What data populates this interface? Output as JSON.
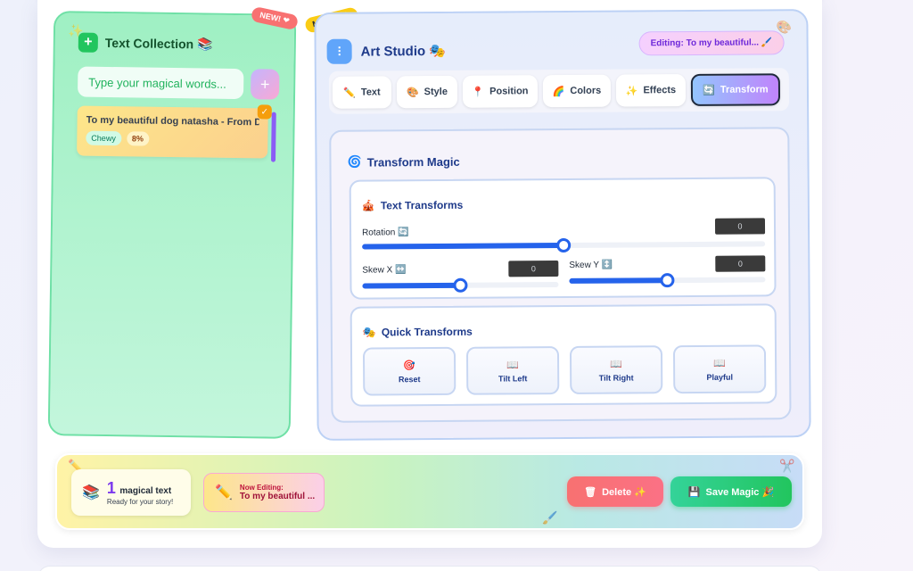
{
  "collection": {
    "title": "Text Collection 📚",
    "input_placeholder": "Type your magical words...",
    "add_label": "+",
    "badge_new": "NEW! ❤",
    "items": [
      {
        "title": "To my beautiful dog natasha - From D...",
        "font": "Chewy",
        "pct": "8%"
      }
    ]
  },
  "studio": {
    "badge_magic": "MAGIC ✨",
    "title": "Art Studio 🎭",
    "editing_pill": "Editing: To my beautiful... 🖌️",
    "tabs": [
      {
        "icon": "✏️",
        "label": "Text"
      },
      {
        "icon": "🎨",
        "label": "Style"
      },
      {
        "icon": "📍",
        "label": "Position"
      },
      {
        "icon": "🌈",
        "label": "Colors"
      },
      {
        "icon": "✨",
        "label": "Effects"
      },
      {
        "icon": "🔄",
        "label": "Transform"
      }
    ],
    "active_tab": "Transform",
    "transform_magic_title": "Transform Magic",
    "text_transforms": {
      "title": "Text Transforms",
      "rotation_label": "Rotation 🔄",
      "rotation_value": "0",
      "rotation_level": 0.5,
      "skew_x_label": "Skew X ↔️",
      "skew_x_value": "0",
      "skew_x_level": 0.5,
      "skew_y_label": "Skew Y ↕️",
      "skew_y_value": "0",
      "skew_y_level": 0.5
    },
    "quick_transforms": {
      "title": "Quick Transforms",
      "buttons": [
        {
          "icon": "🎯",
          "label": "Reset"
        },
        {
          "icon": "📖",
          "label": "Tilt Left"
        },
        {
          "icon": "📖",
          "label": "Tilt Right"
        },
        {
          "icon": "📖",
          "label": "Playful"
        }
      ]
    }
  },
  "footer": {
    "count": "1",
    "count_label": "magical text",
    "count_sub": "Ready for your story!",
    "now_editing_label": "Now Editing:",
    "now_editing_value": "To my beautiful ...",
    "delete_label": "Delete ✨",
    "save_label": "Save Magic 🎉"
  }
}
